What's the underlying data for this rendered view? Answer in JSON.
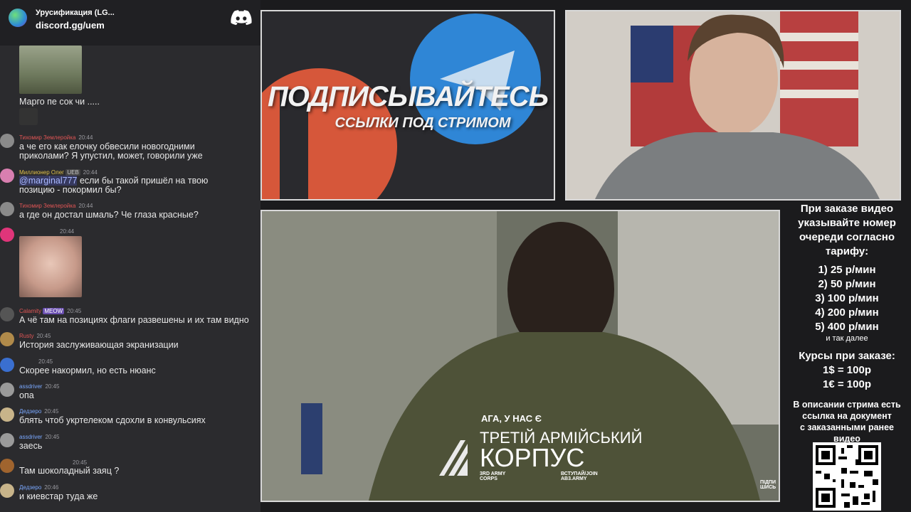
{
  "chat": {
    "server_name": "Урусификация (LG...",
    "invite": "discord.gg/uem",
    "messages": [
      {
        "text": "Марго пе сок чи ....."
      },
      {
        "author": "Тихомир Землеройка",
        "time": "20:44",
        "text": "а че его как елочку обвесили новогодними"
      },
      {
        "text": "приколами? Я упустил, может, говорили уже"
      },
      {
        "author": "Миллионер Олег",
        "badge": "UEB",
        "time": "20:44",
        "mention": "@marginal777",
        "text": " если бы такой пришёл на твою"
      },
      {
        "text": "позицию - покормил бы?"
      },
      {
        "author": "Тихомир Землеройка",
        "time": "20:44",
        "text": "а где он достал шмаль? Че глаза красные?"
      },
      {
        "time": "20:44"
      },
      {
        "author": "Calamity",
        "badge": "MEOW",
        "time": "20:45",
        "text": "А чё там на позициях флаги развешены и их там видно"
      },
      {
        "author": "Rusty",
        "time": "20:45",
        "text": "История заслуживающая экранизации"
      },
      {
        "time": "20:45",
        "text": "Скорее накормил, но есть нюанс"
      },
      {
        "author": "assdriver",
        "time": "20:45",
        "text": "опа"
      },
      {
        "author": "Дедзеро",
        "time": "20:45",
        "text": "блять чтоб укртелеком сдохли в конвульсиях"
      },
      {
        "author": "assdriver",
        "time": "20:45",
        "text": "заесь"
      },
      {
        "time": "20:45",
        "text": "Там шоколадный заяц ?"
      },
      {
        "author": "Дедзеро",
        "time": "20:46",
        "text": "и киевстар туда же"
      }
    ]
  },
  "promo": {
    "title": "ПОДПИСЫВАЙТЕСЬ",
    "subtitle": "ССЫЛКИ ПОД СТРИМОМ"
  },
  "info": {
    "line1": "При заказе видео",
    "line2": "указывайте номер",
    "line3": "очереди согласно",
    "line4": "тарифу:",
    "t1": "1) 25 р/мин",
    "t2": "2) 50 р/мин",
    "t3": "3) 100 р/мин",
    "t4": "4) 200 р/мин",
    "t5": "5) 400 р/мин",
    "etc": "и так далее",
    "courses_title": "Курсы при заказе:",
    "usd": "1$ = 100р",
    "eur": "1€ = 100р",
    "d1": "В описании стрима есть",
    "d2": "ссылка на документ",
    "d3": "с заказанными ранее",
    "d4": "видео"
  },
  "video": {
    "caption": "АГА, У НАС Є",
    "brand1": "ТРЕТІЙ АРМІЙСЬКИЙ",
    "brand2": "КОРПУС",
    "corps1": "3RD ARMY",
    "corps2": "CORPS",
    "join1": "ВСТУПАЙ/JOIN",
    "join2": "AB3.ARMY",
    "sub1": "ПІДПИ",
    "sub2": "ШИСЬ"
  },
  "colors": {
    "chat_bg": "#2b2b2e",
    "author_red": "#e05555",
    "author_yellow": "#e0c14a",
    "author_blue": "#7aa8ff"
  }
}
